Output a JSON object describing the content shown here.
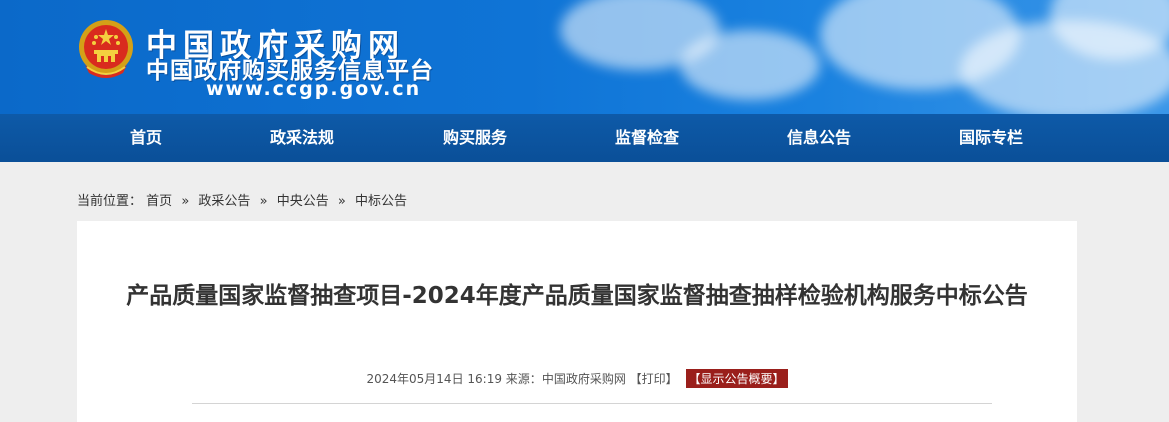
{
  "header": {
    "site_name_cn": "中国政府采购网",
    "site_subtitle": "中国政府购买服务信息平台",
    "site_url": "www.ccgp.gov.cn",
    "brand_color": "#0f74d6"
  },
  "nav": {
    "items": [
      {
        "label": "首页"
      },
      {
        "label": "政采法规"
      },
      {
        "label": "购买服务"
      },
      {
        "label": "监督检查"
      },
      {
        "label": "信息公告"
      },
      {
        "label": "国际专栏"
      }
    ]
  },
  "breadcrumb": {
    "prefix": "当前位置：",
    "items": [
      "首页",
      "政采公告",
      "中央公告",
      "中标公告"
    ],
    "separator": "»"
  },
  "article": {
    "title": "产品质量国家监督抽查项目-2024年度产品质量国家监督抽查抽样检验机构服务中标公告",
    "date": "2024年05月14日 16:19",
    "source_label": "来源：",
    "source": "中国政府采购网",
    "print_label": "【打印】",
    "summary_label": "【显示公告概要】",
    "summary_color": "#9a1f1b"
  }
}
